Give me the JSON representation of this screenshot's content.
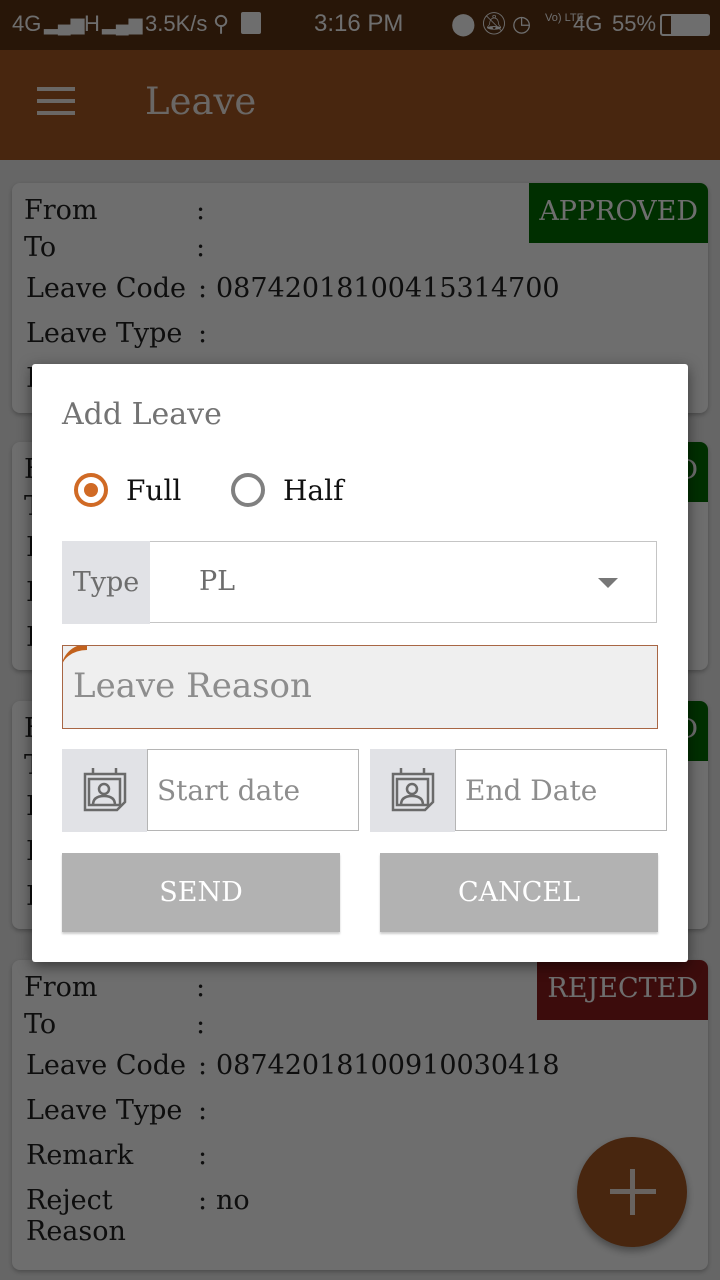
{
  "status_bar": {
    "network_left": "4G",
    "network_h": "H",
    "speed": "3.5K/s",
    "time": "3:16 PM",
    "volte": "Vo) LTE",
    "network_right": "4G",
    "battery": "55%"
  },
  "app_bar": {
    "title": "Leave"
  },
  "cards": [
    {
      "status": "APPROVED",
      "status_color": "#006d00",
      "rows": [
        {
          "label": "From",
          "value": ""
        },
        {
          "label": "To",
          "value": ""
        },
        {
          "label": "Leave Code",
          "value": "08742018100415314700"
        },
        {
          "label": "Leave Type",
          "value": ""
        },
        {
          "label": "Remark",
          "value": ""
        }
      ]
    },
    {
      "status": "APPROVED",
      "status_color": "#006d00",
      "rows": [
        {
          "label": "From",
          "value": ""
        },
        {
          "label": "To",
          "value": ""
        },
        {
          "label": "Leave Code",
          "value": ""
        },
        {
          "label": "Leave Type",
          "value": ""
        },
        {
          "label": "Remark",
          "value": ""
        }
      ]
    },
    {
      "status": "APPROVED",
      "status_color": "#006d00",
      "rows": [
        {
          "label": "From",
          "value": ""
        },
        {
          "label": "To",
          "value": ""
        },
        {
          "label": "Leave Code",
          "value": ""
        },
        {
          "label": "Leave Type",
          "value": ""
        },
        {
          "label": "Remark",
          "value": ""
        }
      ]
    },
    {
      "status": "REJECTED",
      "status_color": "#8b1d1d",
      "rows": [
        {
          "label": "From",
          "value": ""
        },
        {
          "label": "To",
          "value": ""
        },
        {
          "label": "Leave Code",
          "value": "08742018100910030418"
        },
        {
          "label": "Leave Type",
          "value": ""
        },
        {
          "label": "Remark",
          "value": ""
        },
        {
          "label": "Reject Reason",
          "value": "no"
        }
      ]
    }
  ],
  "separator": ":",
  "dialog": {
    "title": "Add Leave",
    "duration_options": [
      {
        "label": "Full",
        "selected": true
      },
      {
        "label": "Half",
        "selected": false
      }
    ],
    "type_label": "Type",
    "type_value": "PL",
    "reason_placeholder": "Leave Reason",
    "start_date_placeholder": "Start date",
    "end_date_placeholder": "End Date",
    "send_label": "SEND",
    "cancel_label": "CANCEL"
  },
  "colors": {
    "primary": "#a85823",
    "accent": "#d06a25",
    "status_bar": "#5e3314",
    "approved": "#006d00",
    "rejected": "#8b1d1d"
  }
}
